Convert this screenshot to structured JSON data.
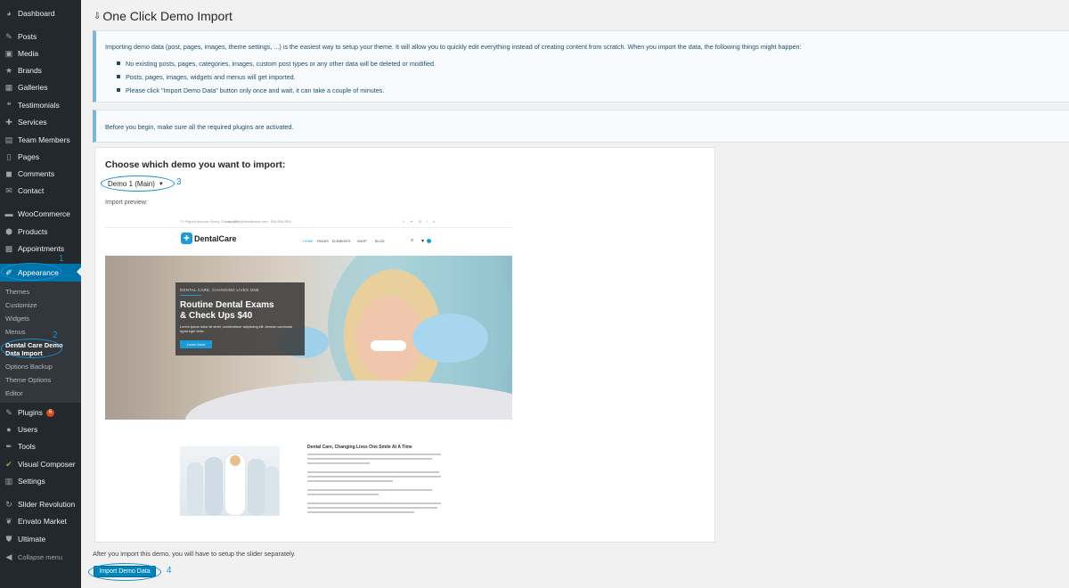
{
  "sidebar": {
    "items": [
      {
        "label": "Dashboard",
        "icon": "dashboard-icon"
      },
      {
        "label": "Posts",
        "icon": "pin-icon"
      },
      {
        "label": "Media",
        "icon": "media-icon"
      },
      {
        "label": "Brands",
        "icon": "star-icon"
      },
      {
        "label": "Galleries",
        "icon": "gallery-icon"
      },
      {
        "label": "Testimonials",
        "icon": "quote-icon"
      },
      {
        "label": "Services",
        "icon": "wrench-icon"
      },
      {
        "label": "Team Members",
        "icon": "team-icon"
      },
      {
        "label": "Pages",
        "icon": "page-icon"
      },
      {
        "label": "Comments",
        "icon": "comment-icon"
      },
      {
        "label": "Contact",
        "icon": "mail-icon"
      },
      {
        "label": "WooCommerce",
        "icon": "woocommerce-icon"
      },
      {
        "label": "Products",
        "icon": "box-icon"
      },
      {
        "label": "Appointments",
        "icon": "calendar-icon"
      },
      {
        "label": "Appearance",
        "icon": "brush-icon"
      },
      {
        "label": "Plugins",
        "icon": "plug-icon",
        "badge": "6"
      },
      {
        "label": "Users",
        "icon": "user-icon"
      },
      {
        "label": "Tools",
        "icon": "tools-icon"
      },
      {
        "label": "Visual Composer",
        "icon": "visual-composer-icon"
      },
      {
        "label": "Settings",
        "icon": "settings-icon"
      },
      {
        "label": "Slider Revolution",
        "icon": "refresh-icon"
      },
      {
        "label": "Envato Market",
        "icon": "leaf-icon"
      },
      {
        "label": "Ultimate",
        "icon": "shield-icon"
      },
      {
        "label": "Collapse menu",
        "icon": "collapse-icon"
      }
    ],
    "submenu": [
      "Themes",
      "Customize",
      "Widgets",
      "Menus",
      "Dental Care Demo",
      "Data Import",
      "Options Backup",
      "Theme Options",
      "Editor"
    ]
  },
  "callouts": [
    "1",
    "2",
    "3",
    "4"
  ],
  "page": {
    "title": "One Click Demo Import",
    "intro": "Importing demo data (post, pages, images, theme settings, ...) is the easiest way to setup your theme. It will allow you to quickly edit everything instead of creating content from scratch. When you import the data, the following things might happen:",
    "bullets": [
      "No existing posts, pages, categories, images, custom post types or any other data will be deleted or modified.",
      "Posts, pages, images, widgets and menus will get imported.",
      "Please click \"Import Demo Data\" button only once and wait, it can take a couple of minutes."
    ],
    "plugins_notice": "Before you begin, make sure all the required plugins are activated.",
    "choose_label": "Choose which demo you want to import:",
    "demo_select_value": "Demo 1 (Main)",
    "preview_label": "Import preview:",
    "after_text": "After you import this demo, you will have to setup the slider separately.",
    "import_button": "Import Demo Data"
  },
  "preview": {
    "topbar_address": "71 Pilgrim Avenue Chevy Chase, MD",
    "topbar_email": "support@dentalcare.com",
    "topbar_phone": "555-555-555",
    "logo_text": "DentalCare",
    "nav": [
      "HOME",
      "PAGES",
      "ELEMENTS",
      "SHOP",
      "BLOG"
    ],
    "hero_tag": "DENTAL CARE, CHANGING LIVES ONE",
    "hero_headline_1": "Routine Dental Exams",
    "hero_headline_2": "& Check Ups $40",
    "hero_body": "Lorem ipsum dolor sit amet, consectetuer adipiscing elit. Aenean commodo ligula eget dolor.",
    "hero_button": "Learn More",
    "about_title": "Dental Care, Changing Lives One Smile At A Time"
  },
  "colors": {
    "sidebar_bg": "#23282d",
    "accent": "#0073aa",
    "callout": "#1a8fd6",
    "button": "#0085ba"
  }
}
